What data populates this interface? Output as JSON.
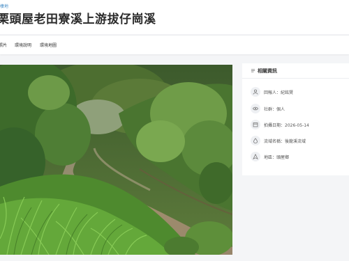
{
  "header": {
    "breadcrumb": "棲地",
    "title": "栗頭屋老田寮溪上游拔仔崗溪"
  },
  "tabs": [
    {
      "label": "照片"
    },
    {
      "label": "環境說明"
    },
    {
      "label": "環境地圖"
    }
  ],
  "info": {
    "title": "相關資訊",
    "rows": [
      {
        "icon": "user-icon",
        "text": "回報人：紀銘賢"
      },
      {
        "icon": "eye-icon",
        "text": "社群：個人"
      },
      {
        "icon": "calendar-icon",
        "text": "拍攝日期：2026-05-14"
      },
      {
        "icon": "water-drop-icon",
        "text": "流域名稱：後龍溪流域"
      },
      {
        "icon": "location-icon",
        "text": "地區：頭屋鄉"
      }
    ]
  }
}
